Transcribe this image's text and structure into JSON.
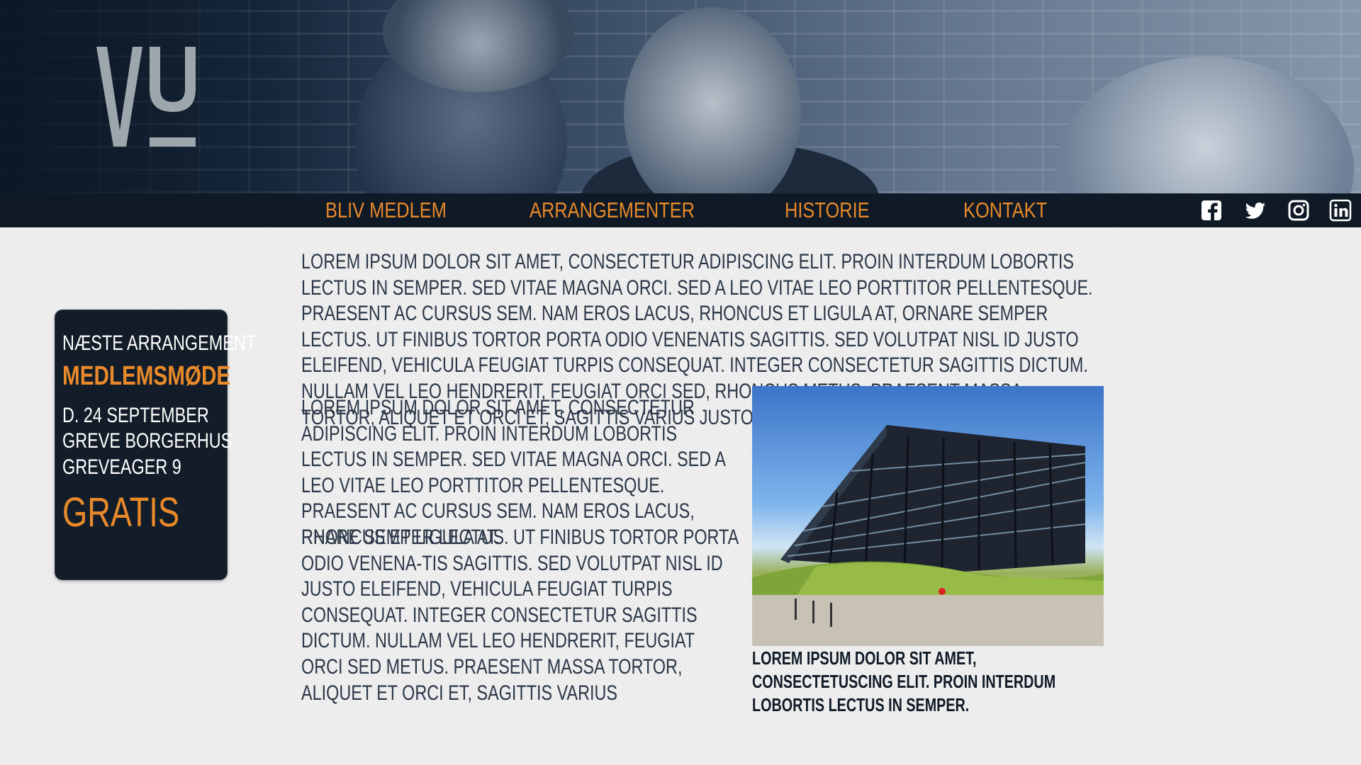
{
  "header": {
    "logo_text": "VU"
  },
  "nav": {
    "items": [
      {
        "label": "BLIV MEDLEM"
      },
      {
        "label": "ARRANGEMENTER"
      },
      {
        "label": "HISTORIE"
      },
      {
        "label": "KONTAKT"
      }
    ],
    "social": [
      "facebook-icon",
      "twitter-icon",
      "instagram-icon",
      "linkedin-icon"
    ]
  },
  "event": {
    "heading": "NÆSTE ARRANGEMENT",
    "title": "MEDLEMSMØDE",
    "date": "D. 24 SEPTEMBER",
    "venue": "GREVE BORGERHUS",
    "address": "GREVEAGER 9",
    "price": "GRATIS"
  },
  "content": {
    "intro": "LOREM IPSUM DOLOR SIT AMET, CONSECTETUR ADIPISCING ELIT. PROIN INTERDUM LOBORTIS LECTUS IN SEMPER. SED VITAE MAGNA ORCI. SED A LEO VITAE LEO PORTTITOR PELLENTESQUE. PRAESENT AC CURSUS SEM. NAM EROS LACUS, RHONCUS ET LIGULA AT, ORNARE SEMPER LECTUS. UT FINIBUS TORTOR PORTA ODIO VENENATIS SAGITTIS. SED VOLUTPAT NISL ID JUSTO ELEIFEND, VEHICULA FEUGIAT TURPIS CONSEQUAT. INTEGER CONSECTETUR SAGITTIS DICTUM. NULLAM VEL LEO HENDRERIT, FEUGIAT ORCI SED, RHONCUS METUS. PRAESENT MASSA TORTOR, ALIQUET ET ORCI ET, SAGITTIS VARIUS JUSTO.",
    "paragraph2": "LOREM IPSUM DOLOR SIT AMET, CONSECTETUR ADIPISCING ELIT. PROIN INTERDUM LOBORTIS LECTUS IN SEMPER. SED VITAE MAGNA ORCI. SED A LEO VITAE LEO PORTTITOR PELLENTESQUE. PRAESENT AC CURSUS SEM. NAM EROS LACUS, RHONCUS ET LIGULA AT.",
    "paragraph3": "RNARE SEMPER LECTUS. UT FINIBUS TORTOR PORTA ODIO VENENA-TIS SAGITTIS. SED VOLUTPAT NISL ID JUSTO ELEIFEND, VEHICULA FEUGIAT TURPIS CONSEQUAT. INTEGER CONSECTETUR SAGITTIS DICTUM. NULLAM VEL LEO HENDRERIT, FEUGIAT ORCI SED METUS. PRAESENT MASSA TORTOR, ALIQUET ET ORCI ET, SAGITTIS VARIUS",
    "photo_caption": "LOREM IPSUM DOLOR SIT AMET, CONSECTETUSCING ELIT. PROIN INTERDUM LOBORTIS LECTUS IN SEMPER."
  },
  "colors": {
    "accent": "#e9892a",
    "nav_bg": "#0f1a26",
    "text": "#2b3748"
  }
}
